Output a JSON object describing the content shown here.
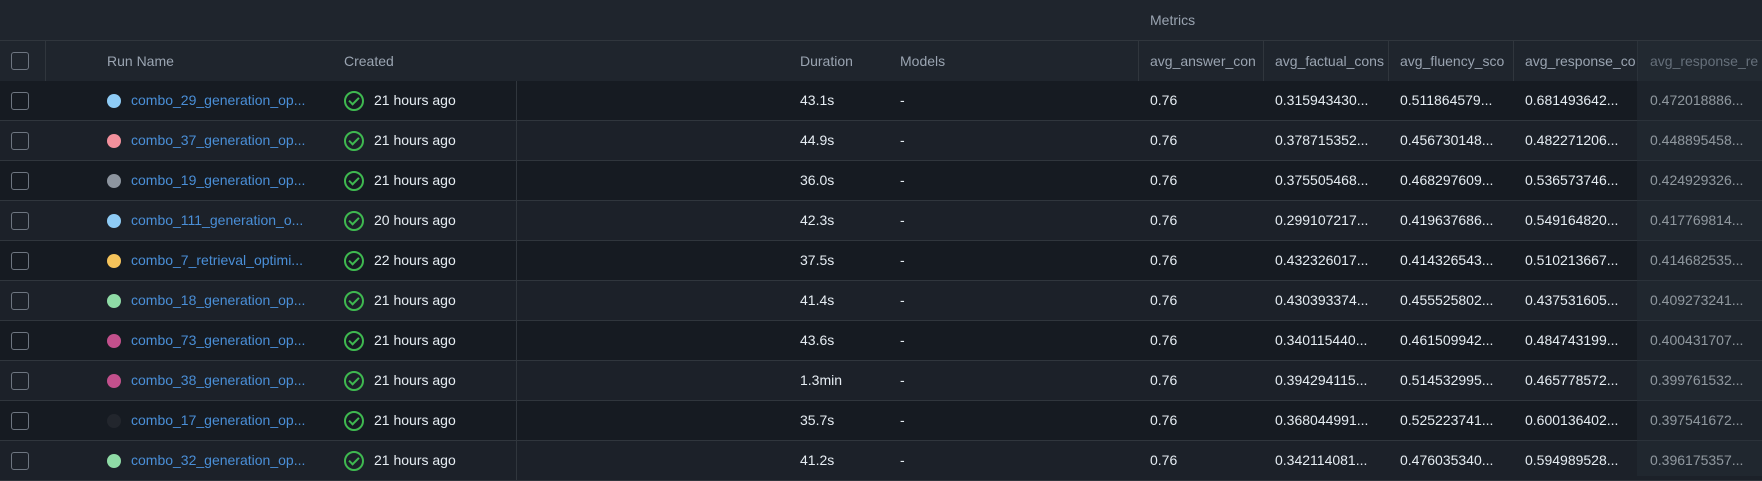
{
  "group_header": {
    "metrics_label": "Metrics"
  },
  "columns": {
    "run_name": "Run Name",
    "created": "Created",
    "duration": "Duration",
    "models": "Models",
    "m1": "avg_answer_con",
    "m2": "avg_factual_cons",
    "m3": "avg_fluency_sco",
    "m4": "avg_response_co",
    "m5": "avg_response_re"
  },
  "rows": [
    {
      "name": "combo_29_generation_op...",
      "color": "#8ecbf5",
      "created": "21 hours ago",
      "duration": "43.1s",
      "models": "-",
      "m1": "0.76",
      "m2": "0.315943430...",
      "m3": "0.511864579...",
      "m4": "0.681493642...",
      "m5": "0.472018886..."
    },
    {
      "name": "combo_37_generation_op...",
      "color": "#f2909c",
      "created": "21 hours ago",
      "duration": "44.9s",
      "models": "-",
      "m1": "0.76",
      "m2": "0.378715352...",
      "m3": "0.456730148...",
      "m4": "0.482271206...",
      "m5": "0.448895458..."
    },
    {
      "name": "combo_19_generation_op...",
      "color": "#8d959f",
      "created": "21 hours ago",
      "duration": "36.0s",
      "models": "-",
      "m1": "0.76",
      "m2": "0.375505468...",
      "m3": "0.468297609...",
      "m4": "0.536573746...",
      "m5": "0.424929326..."
    },
    {
      "name": "combo_111_generation_o...",
      "color": "#8ecbf5",
      "created": "20 hours ago",
      "duration": "42.3s",
      "models": "-",
      "m1": "0.76",
      "m2": "0.299107217...",
      "m3": "0.419637686...",
      "m4": "0.549164820...",
      "m5": "0.417769814..."
    },
    {
      "name": "combo_7_retrieval_optimi...",
      "color": "#f5c35b",
      "created": "22 hours ago",
      "duration": "37.5s",
      "models": "-",
      "m1": "0.76",
      "m2": "0.432326017...",
      "m3": "0.414326543...",
      "m4": "0.510213667...",
      "m5": "0.414682535..."
    },
    {
      "name": "combo_18_generation_op...",
      "color": "#8fdba6",
      "created": "21 hours ago",
      "duration": "41.4s",
      "models": "-",
      "m1": "0.76",
      "m2": "0.430393374...",
      "m3": "0.455525802...",
      "m4": "0.437531605...",
      "m5": "0.409273241..."
    },
    {
      "name": "combo_73_generation_op...",
      "color": "#c2508c",
      "created": "21 hours ago",
      "duration": "43.6s",
      "models": "-",
      "m1": "0.76",
      "m2": "0.340115440...",
      "m3": "0.461509942...",
      "m4": "0.484743199...",
      "m5": "0.400431707..."
    },
    {
      "name": "combo_38_generation_op...",
      "color": "#c2508c",
      "created": "21 hours ago",
      "duration": "1.3min",
      "models": "-",
      "m1": "0.76",
      "m2": "0.394294115...",
      "m3": "0.514532995...",
      "m4": "0.465778572...",
      "m5": "0.399761532..."
    },
    {
      "name": "combo_17_generation_op...",
      "color": "#22262d",
      "created": "21 hours ago",
      "duration": "35.7s",
      "models": "-",
      "m1": "0.76",
      "m2": "0.368044991...",
      "m3": "0.525223741...",
      "m4": "0.600136402...",
      "m5": "0.397541672..."
    },
    {
      "name": "combo_32_generation_op...",
      "color": "#8fdba6",
      "created": "21 hours ago",
      "duration": "41.2s",
      "models": "-",
      "m1": "0.76",
      "m2": "0.342114081...",
      "m3": "0.476035340...",
      "m4": "0.594989528...",
      "m5": "0.396175357..."
    }
  ]
}
